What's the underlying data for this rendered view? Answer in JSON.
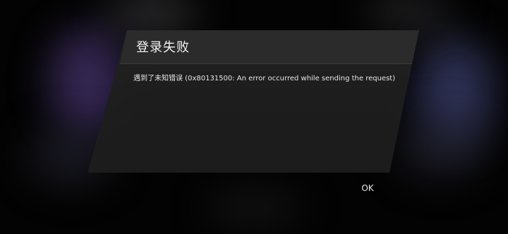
{
  "dialog": {
    "title": "登录失败",
    "message": "遇到了未知错误 (0x80131500: An error occurred while sending the request)",
    "ok_label": "OK"
  }
}
